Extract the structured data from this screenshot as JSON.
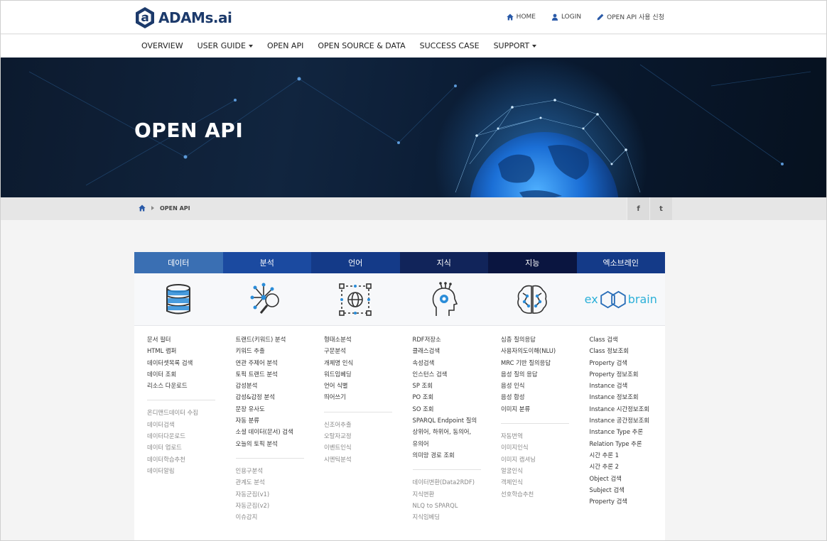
{
  "brand": {
    "name": "ADAMs.ai"
  },
  "top_links": [
    {
      "label": "HOME",
      "icon": "home-icon"
    },
    {
      "label": "LOGIN",
      "icon": "user-icon"
    },
    {
      "label": "OPEN API 사용 신청",
      "icon": "pencil-icon"
    }
  ],
  "nav": [
    "OVERVIEW",
    "USER GUIDE",
    "OPEN API",
    "OPEN SOURCE & DATA",
    "SUCCESS CASE",
    "SUPPORT"
  ],
  "hero": {
    "title": "OPEN API"
  },
  "breadcrumb": {
    "current": "OPEN API"
  },
  "social": {
    "facebook": "f",
    "twitter": "t"
  },
  "tabs": [
    {
      "label": "데이터",
      "color": "#3a6fb3"
    },
    {
      "label": "분석",
      "color": "#1b4aa0"
    },
    {
      "label": "언어",
      "color": "#143a88"
    },
    {
      "label": "지식",
      "color": "#11245a"
    },
    {
      "label": "지능",
      "color": "#0a1540"
    },
    {
      "label": "엑소브레인",
      "color": "#143a88"
    }
  ],
  "exobrain_logo": {
    "left": "ex",
    "right": "brain"
  },
  "columns": [
    {
      "main": [
        "문서 필터",
        "HTML 랩퍼",
        "데이터셋목록 검색",
        "데이터 조회",
        "리소스 다운로드"
      ],
      "sub": [
        "온디맨드데이터 수집",
        "데이터검색",
        "데이터다운로드",
        "데이터 업로드",
        "데이터학습추천",
        "데이터알림"
      ]
    },
    {
      "main": [
        "트랜드(키워드) 분석",
        "키워드 추출",
        "연관 주제어 분석",
        "토픽 트랜드 분석",
        "감성분석",
        "감성&감정 분석",
        "문장 유사도",
        "자동 분류",
        "소셜 데이터(문서) 검색",
        "오늘의 토픽 분석"
      ],
      "sub": [
        "인용구분석",
        "관계도 분석",
        "자동군집(v1)",
        "자동군집(v2)",
        "이슈감지"
      ]
    },
    {
      "main": [
        "형태소분석",
        "구문분석",
        "개체명 인식",
        "워드임베딩",
        "언어 식별",
        "띄어쓰기"
      ],
      "sub": [
        "신조어추출",
        "오탈자교정",
        "이벤트인식",
        "시멘틱분석"
      ]
    },
    {
      "main": [
        "RDF저장소",
        "클래스검색",
        "속성검색",
        "인스턴스 검색",
        "SP 조회",
        "PO 조회",
        "SO 조회",
        "SPARQL Endpoint 질의",
        "상위어, 하위어, 동의어,",
        "유의어",
        "의미망 경로 조회"
      ],
      "sub": [
        "데이터변환(Data2RDF)",
        "지식변환",
        "NLQ to SPARQL",
        "지식임베딩"
      ]
    },
    {
      "main": [
        "심층 질의응답",
        "사용자의도이해(NLU)",
        "MRC 기반 질의응답",
        "음성 질의 응답",
        "음성 인식",
        "음성 합성",
        "이미지 분류"
      ],
      "sub": [
        "자동번역",
        "이미지인식",
        "이미지 캡셔닝",
        "얼굴인식",
        "객체인식",
        "선호학습추천"
      ]
    },
    {
      "main": [
        "Class 검색",
        "Class 정보조회",
        "Property 검색",
        "Property 정보조회",
        "Instance 검색",
        "Instance 정보조회",
        "Instance 시간정보조회",
        "Instance 공간정보조회",
        "Instance Type 추론",
        "Relation Type 추론",
        "시간 추론 1",
        "시간 추론 2",
        "Object 검색",
        "Subject 검색",
        "Property 검색"
      ],
      "sub": []
    }
  ]
}
